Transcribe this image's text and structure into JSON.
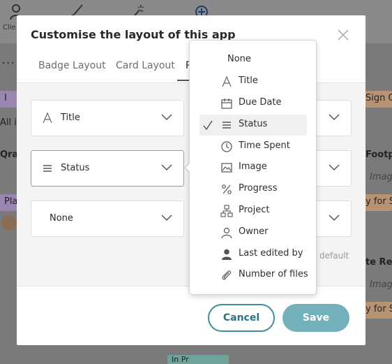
{
  "background": {
    "toolbar_label": "Clie",
    "left_snippets": [
      "I",
      "All it",
      "Qra",
      "Pla"
    ],
    "right_snippets": [
      "Sign O",
      "Footp",
      "Imag",
      "y for Si",
      "te Red",
      "Imag",
      "y for Si"
    ],
    "bottom_snippet": "In Pr"
  },
  "modal": {
    "title": "Customise the layout of this app",
    "tabs": [
      "Badge Layout",
      "Card Layout",
      "R"
    ],
    "rows": [
      {
        "left": "Title",
        "right": ""
      },
      {
        "left": "Status",
        "right": ""
      },
      {
        "left": "None",
        "right": ""
      }
    ],
    "reset_label": "default",
    "cancel_label": "Cancel",
    "save_label": "Save"
  },
  "menu": {
    "selected": "Status",
    "options": [
      {
        "label": "None",
        "icon": ""
      },
      {
        "label": "Title",
        "icon": "title-text-icon"
      },
      {
        "label": "Due Date",
        "icon": "calendar-icon"
      },
      {
        "label": "Status",
        "icon": "status-lines-icon"
      },
      {
        "label": "Time Spent",
        "icon": "clock-icon"
      },
      {
        "label": "Image",
        "icon": "image-icon"
      },
      {
        "label": "Progress",
        "icon": "percent-icon"
      },
      {
        "label": "Project",
        "icon": "hierarchy-icon"
      },
      {
        "label": "Owner",
        "icon": "person-outline-icon"
      },
      {
        "label": "Last edited by",
        "icon": "person-filled-icon"
      },
      {
        "label": "Number of files",
        "icon": "paperclip-icon"
      }
    ]
  },
  "colors": {
    "accent": "#3f8d9a",
    "save_disabled": "#74b1bb"
  }
}
